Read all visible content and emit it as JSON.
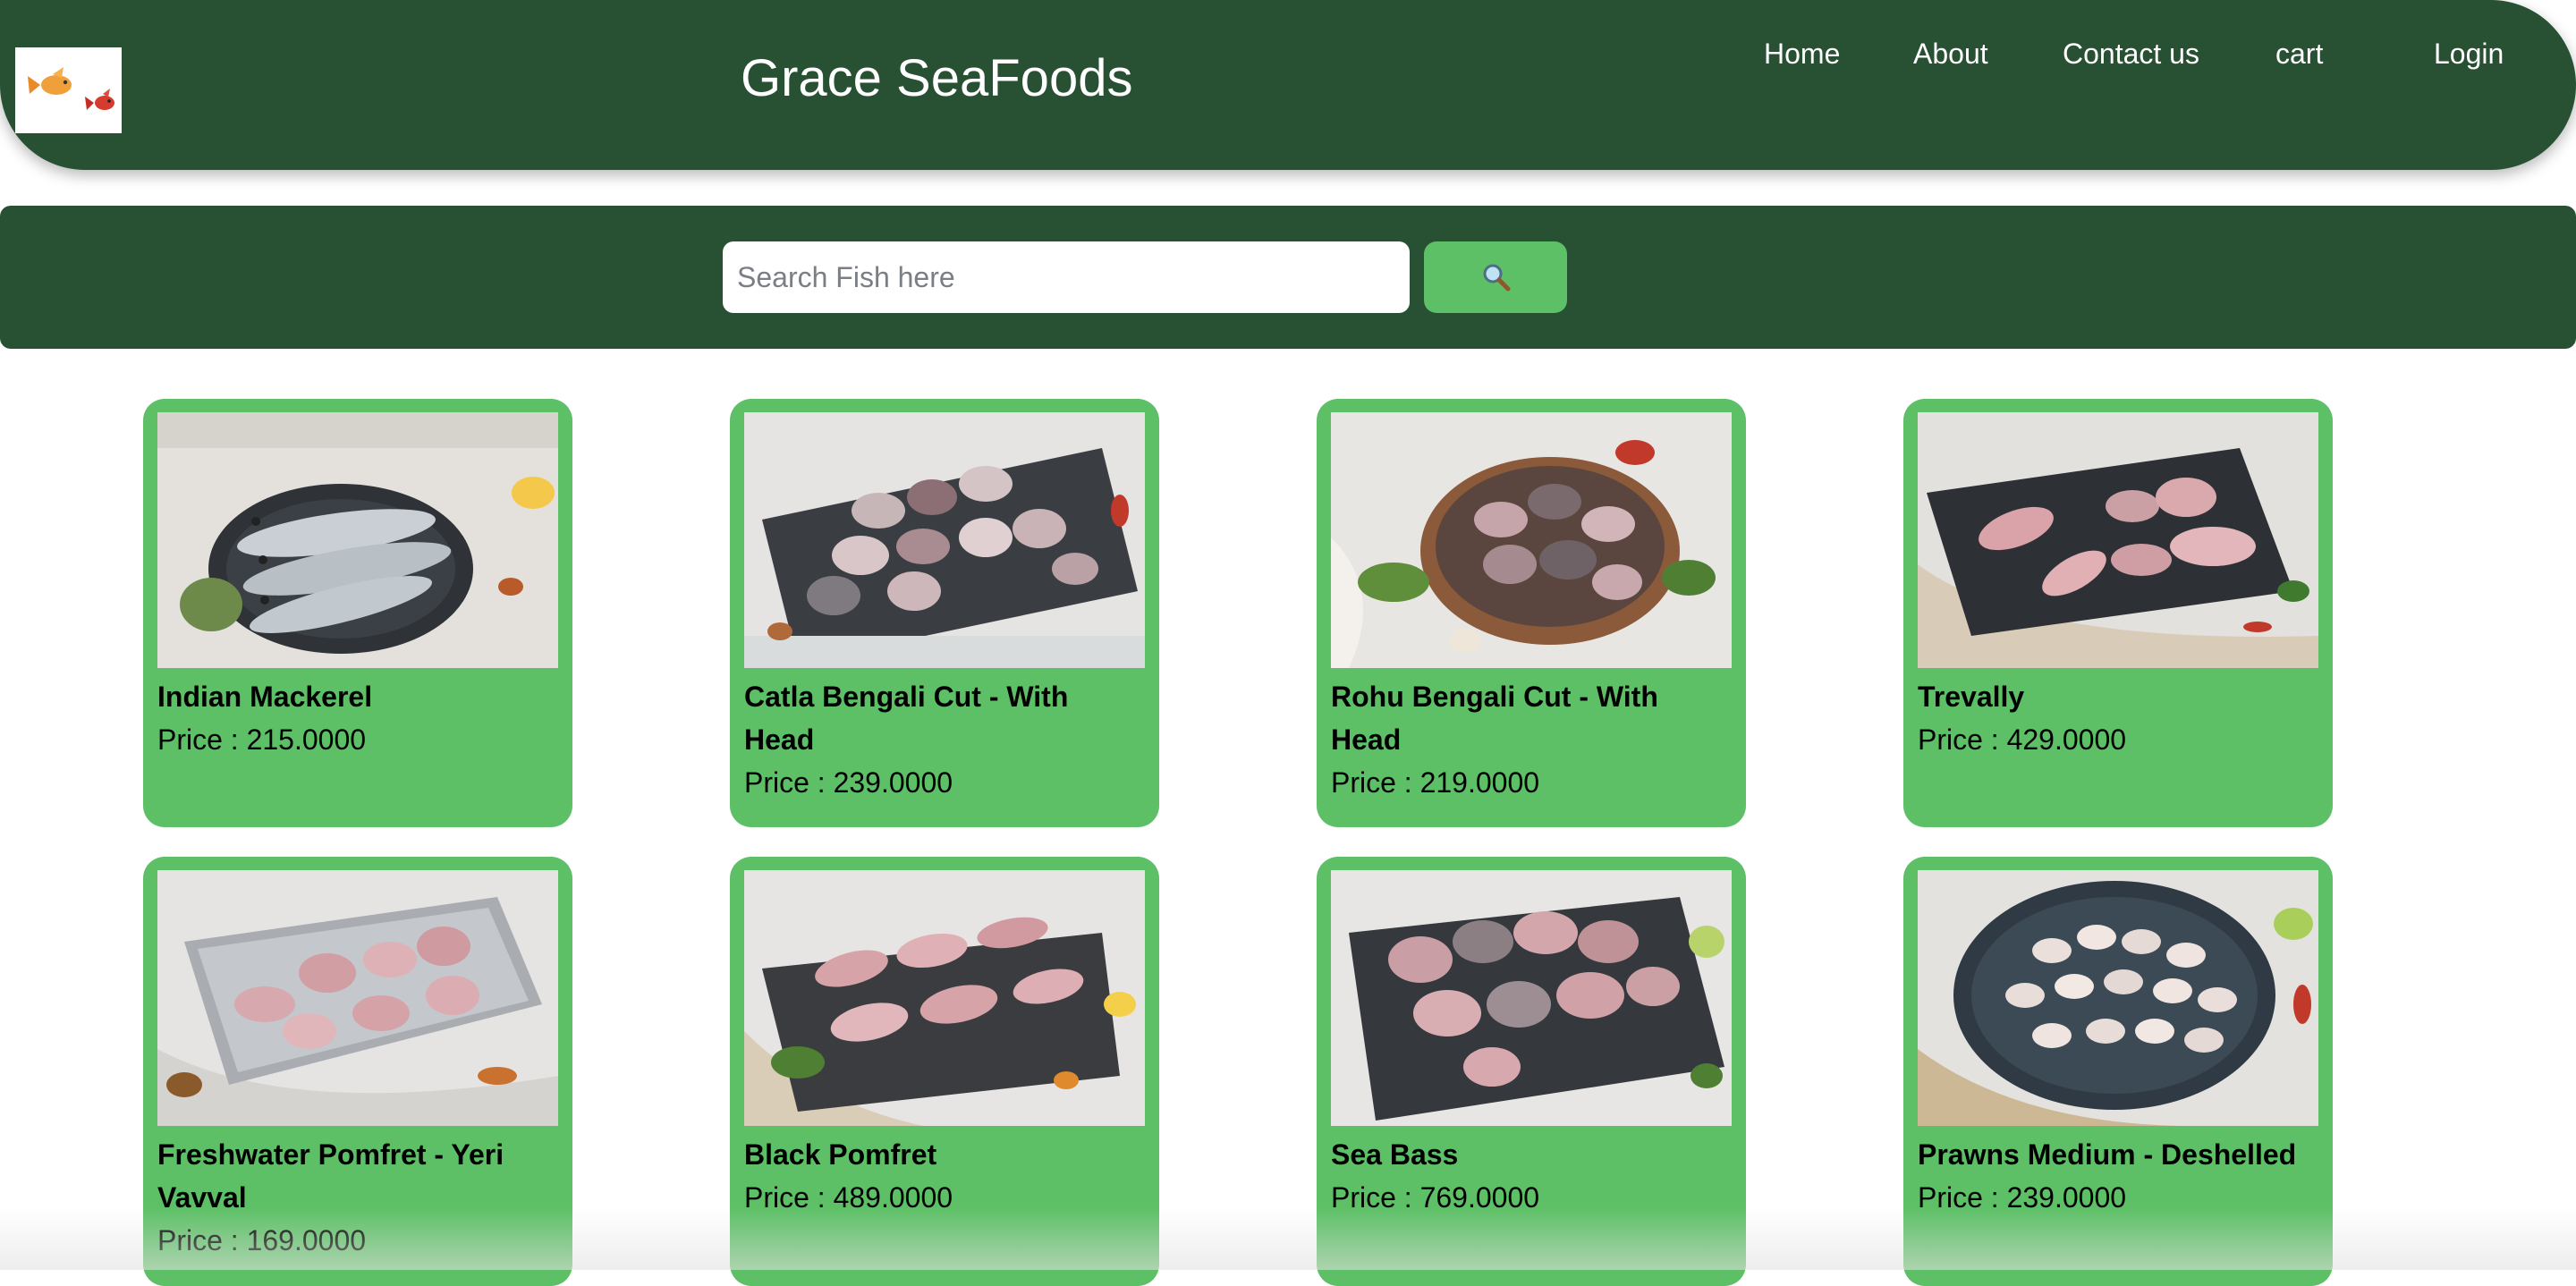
{
  "header": {
    "brand": "Grace SeaFoods",
    "logo_icon": "fish-logo-icon",
    "nav": [
      {
        "label": "Home"
      },
      {
        "label": "About"
      },
      {
        "label": "Contact us"
      },
      {
        "label": "cart"
      },
      {
        "label": "Login"
      }
    ]
  },
  "search": {
    "placeholder": "Search Fish here",
    "button_icon": "search-icon"
  },
  "colors": {
    "header_bg": "#285133",
    "card_bg": "#5dc066",
    "button_bg": "#5dc066"
  },
  "products": [
    {
      "name": "Indian Mackerel",
      "price": "Price : 215.0000"
    },
    {
      "name": "Catla Bengali Cut - With Head",
      "price": "Price : 239.0000"
    },
    {
      "name": "Rohu Bengali Cut - With Head",
      "price": "Price : 219.0000"
    },
    {
      "name": "Trevally",
      "price": "Price : 429.0000"
    },
    {
      "name": "Freshwater Pomfret - Yeri Vavval",
      "price": "Price : 169.0000"
    },
    {
      "name": "Black Pomfret",
      "price": "Price : 489.0000"
    },
    {
      "name": "Sea Bass",
      "price": "Price : 769.0000"
    },
    {
      "name": "Prawns Medium - Deshelled",
      "price": "Price : 239.0000"
    }
  ]
}
